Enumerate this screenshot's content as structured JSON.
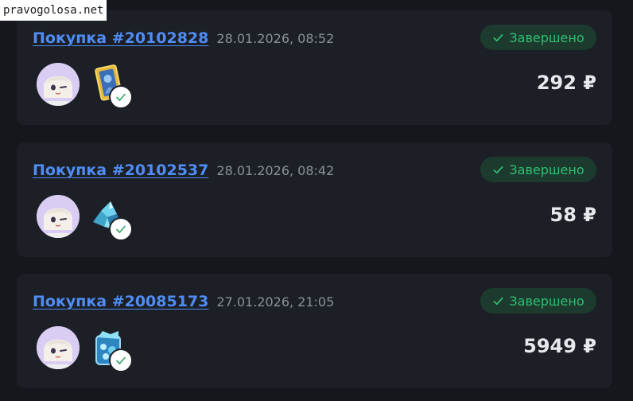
{
  "watermark": "pravogolosa.net",
  "orders": [
    {
      "title": "Покупка #20102828",
      "date": "28.01.2026, 08:52",
      "status": "Завершено",
      "price": "292 ₽",
      "item_icon": "golden-card-icon"
    },
    {
      "title": "Покупка #20102537",
      "date": "28.01.2026, 08:42",
      "status": "Завершено",
      "price": "58 ₽",
      "item_icon": "crystal-cluster-icon"
    },
    {
      "title": "Покупка #20085173",
      "date": "27.01.2026, 21:05",
      "status": "Завершено",
      "price": "5949 ₽",
      "item_icon": "crystal-pack-icon"
    }
  ],
  "colors": {
    "background": "#15171d",
    "card": "#1c1f26",
    "link": "#4f8df5",
    "status_text": "#2fbf71",
    "status_bg": "#1d3a2f"
  }
}
